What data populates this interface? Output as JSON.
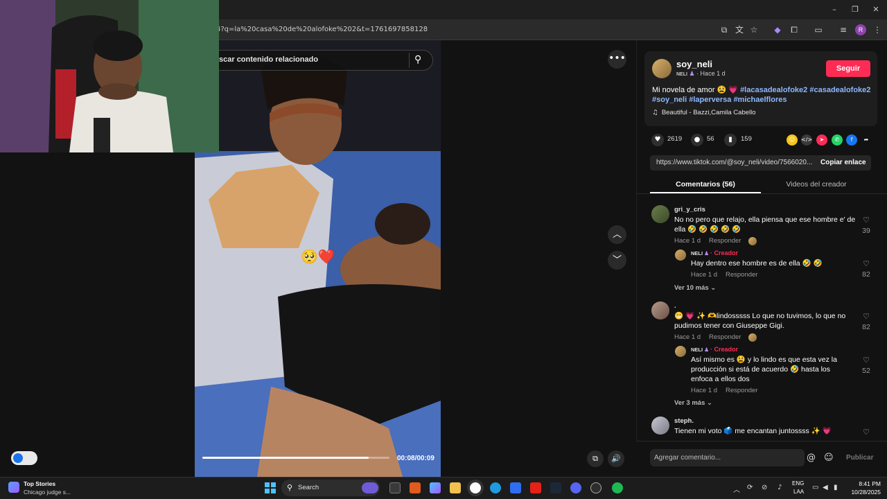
{
  "browser": {
    "url": "4?q=la%20casa%20de%20alofoke%202&t=1761697858128",
    "profile_initial": "R"
  },
  "video": {
    "search_placeholder": "scar contenido relacionado",
    "elapsed": "00:08",
    "duration": "00:09",
    "time_display": "00:08/00:09",
    "progress_fraction": 0.89,
    "overlay_emojis": "🥺❤️"
  },
  "post": {
    "author": "soy_neli",
    "author_badge": "NELI",
    "posted": "· Hace 1 d",
    "follow_label": "Seguir",
    "caption_text": "Mi novela de amor 😫 💗",
    "hashtags": [
      "#lacasadealofoke2",
      "#casadealofoke2",
      "#soy_neli",
      "#laperversa",
      "#michaelflores"
    ],
    "music": "Beautiful - Bazzi,Camila Cabello",
    "likes": "2619",
    "comments": "56",
    "saves": "159",
    "share_link": "https://www.tiktok.com/@soy_neli/video/7566020...",
    "copy_link_label": "Copiar enlace"
  },
  "tabs": {
    "comments": "Comentarios (56)",
    "videos": "Videos del creador"
  },
  "comments": [
    {
      "user": "gri_y_cris",
      "text": "No no pero que relajo, ella piensa que ese hombre e' de ella 🤣 🤣 🤣 🤣 🤣",
      "time": "Hace 1 d",
      "reply_label": "Responder",
      "likes": "39",
      "reply": {
        "user": "NELI",
        "creator_label": "· Creador",
        "text": "Hay dentro ese hombre es de ella 🤣 🤣",
        "time": "Hace 1 d",
        "reply_label": "Responder",
        "likes": "82"
      },
      "more": "Ver 10 más"
    },
    {
      "user": ".",
      "text": "😁 💗 ✨ 🫶lindosssss Lo que no tuvimos, lo que no pudimos tener con Giuseppe Gigi.",
      "time": "Hace 1 d",
      "reply_label": "Responder",
      "likes": "82",
      "reply": {
        "user": "NELI",
        "creator_label": "· Creador",
        "text": "Así mismo es 😫 y lo lindo es que esta vez la producción si está de acuerdo 🤣 hasta los enfoca a ellos dos",
        "time": "Hace 1 d",
        "reply_label": "Responder",
        "likes": "52"
      },
      "more": "Ver 3 más"
    },
    {
      "user": "steph.",
      "text": "Tienen mi voto 🗳️ me encantan juntossss ✨ 💗",
      "time": "",
      "reply_label": "",
      "likes": ""
    }
  ],
  "comment_box": {
    "placeholder": "Agregar comentario...",
    "publish_label": "Publicar"
  },
  "taskbar": {
    "news_title": "Top Stories",
    "news_subtitle": "Chicago judge s...",
    "search_label": "Search",
    "lang_line1": "ENG",
    "lang_line2": "LAA",
    "time": "8:41 PM",
    "date": "10/28/2025"
  },
  "colors": {
    "accent": "#fe2c55",
    "hashtag": "#8fb8ff",
    "background": "#121212"
  }
}
